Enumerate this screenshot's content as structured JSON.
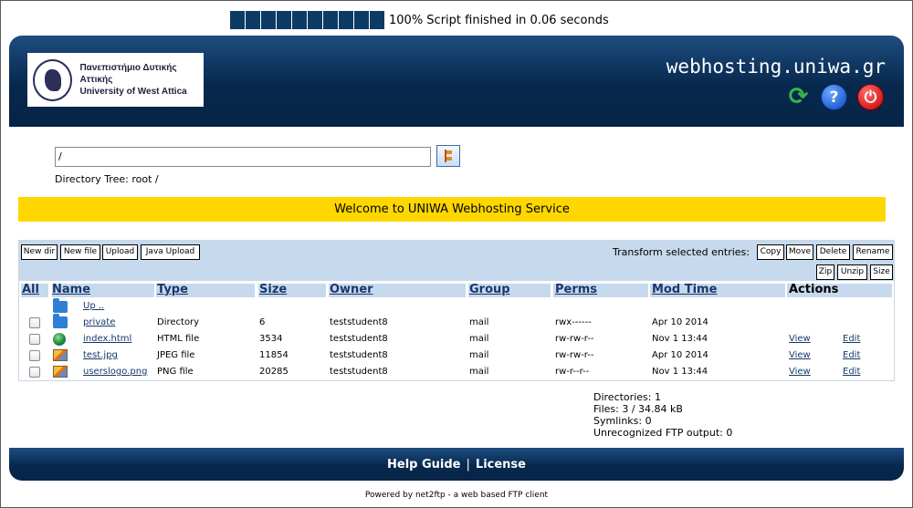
{
  "progress": {
    "value_percent": 100,
    "text": "100% Script finished in 0.06 seconds"
  },
  "header": {
    "logo_text_gr": "Πανεπιστήμιο Δυτικής Αττικής",
    "logo_text_en": "University of West Attica",
    "site_title": "webhosting.uniwa.gr",
    "icons": [
      "refresh-icon",
      "help-icon",
      "power-icon"
    ],
    "help_glyph": "?",
    "power_glyph": "⏻",
    "refresh_glyph": "⟳"
  },
  "path": {
    "value": "/",
    "tree_label": "Directory Tree:",
    "tree_root": "root",
    "tree_sep": "/"
  },
  "welcome": "Welcome to UNIWA Webhosting Service",
  "toolbar": {
    "new_dir": "New dir",
    "new_file": "New file",
    "upload": "Upload",
    "java_upload": "Java Upload",
    "transform_label": "Transform selected entries:",
    "copy": "Copy",
    "move": "Move",
    "delete": "Delete",
    "rename": "Rename",
    "zip": "Zip",
    "unzip": "Unzip",
    "size": "Size"
  },
  "table": {
    "headers": {
      "all": "All",
      "name": "Name",
      "type": "Type",
      "size": "Size",
      "owner": "Owner",
      "group": "Group",
      "perms": "Perms",
      "mod_time": "Mod Time",
      "actions": "Actions"
    },
    "up_label": "Up ..",
    "rows": [
      {
        "name": "private",
        "type": "Directory",
        "size": "6",
        "owner": "teststudent8",
        "group": "mail",
        "perms": "rwx------",
        "mod_time": "Apr 10 2014",
        "view": "",
        "edit": "",
        "icon": "folder-icon"
      },
      {
        "name": "index.html",
        "type": "HTML file",
        "size": "3534",
        "owner": "teststudent8",
        "group": "mail",
        "perms": "rw-rw-r--",
        "mod_time": "Nov 1 13:44",
        "view": "View",
        "edit": "Edit",
        "icon": "html-file-icon"
      },
      {
        "name": "test.jpg",
        "type": "JPEG file",
        "size": "11854",
        "owner": "teststudent8",
        "group": "mail",
        "perms": "rw-rw-r--",
        "mod_time": "Apr 10 2014",
        "view": "View",
        "edit": "Edit",
        "icon": "image-file-icon"
      },
      {
        "name": "userslogo.png",
        "type": "PNG file",
        "size": "20285",
        "owner": "teststudent8",
        "group": "mail",
        "perms": "rw-r--r--",
        "mod_time": "Nov 1 13:44",
        "view": "View",
        "edit": "Edit",
        "icon": "image-file-icon"
      }
    ]
  },
  "summary": {
    "directories": "Directories: 1",
    "files": "Files: 3 / 34.84 kB",
    "symlinks": "Symlinks: 0",
    "unrecognized": "Unrecognized FTP output: 0"
  },
  "footer": {
    "help": "Help Guide",
    "separator": "|",
    "license": "License"
  },
  "powered": "Powered by net2ftp - a web based FTP client",
  "colors": {
    "header_bg": "#062447",
    "welcome_bg": "#ffd700",
    "toolbar_bg": "#c7d9ec",
    "link": "#17386b"
  }
}
